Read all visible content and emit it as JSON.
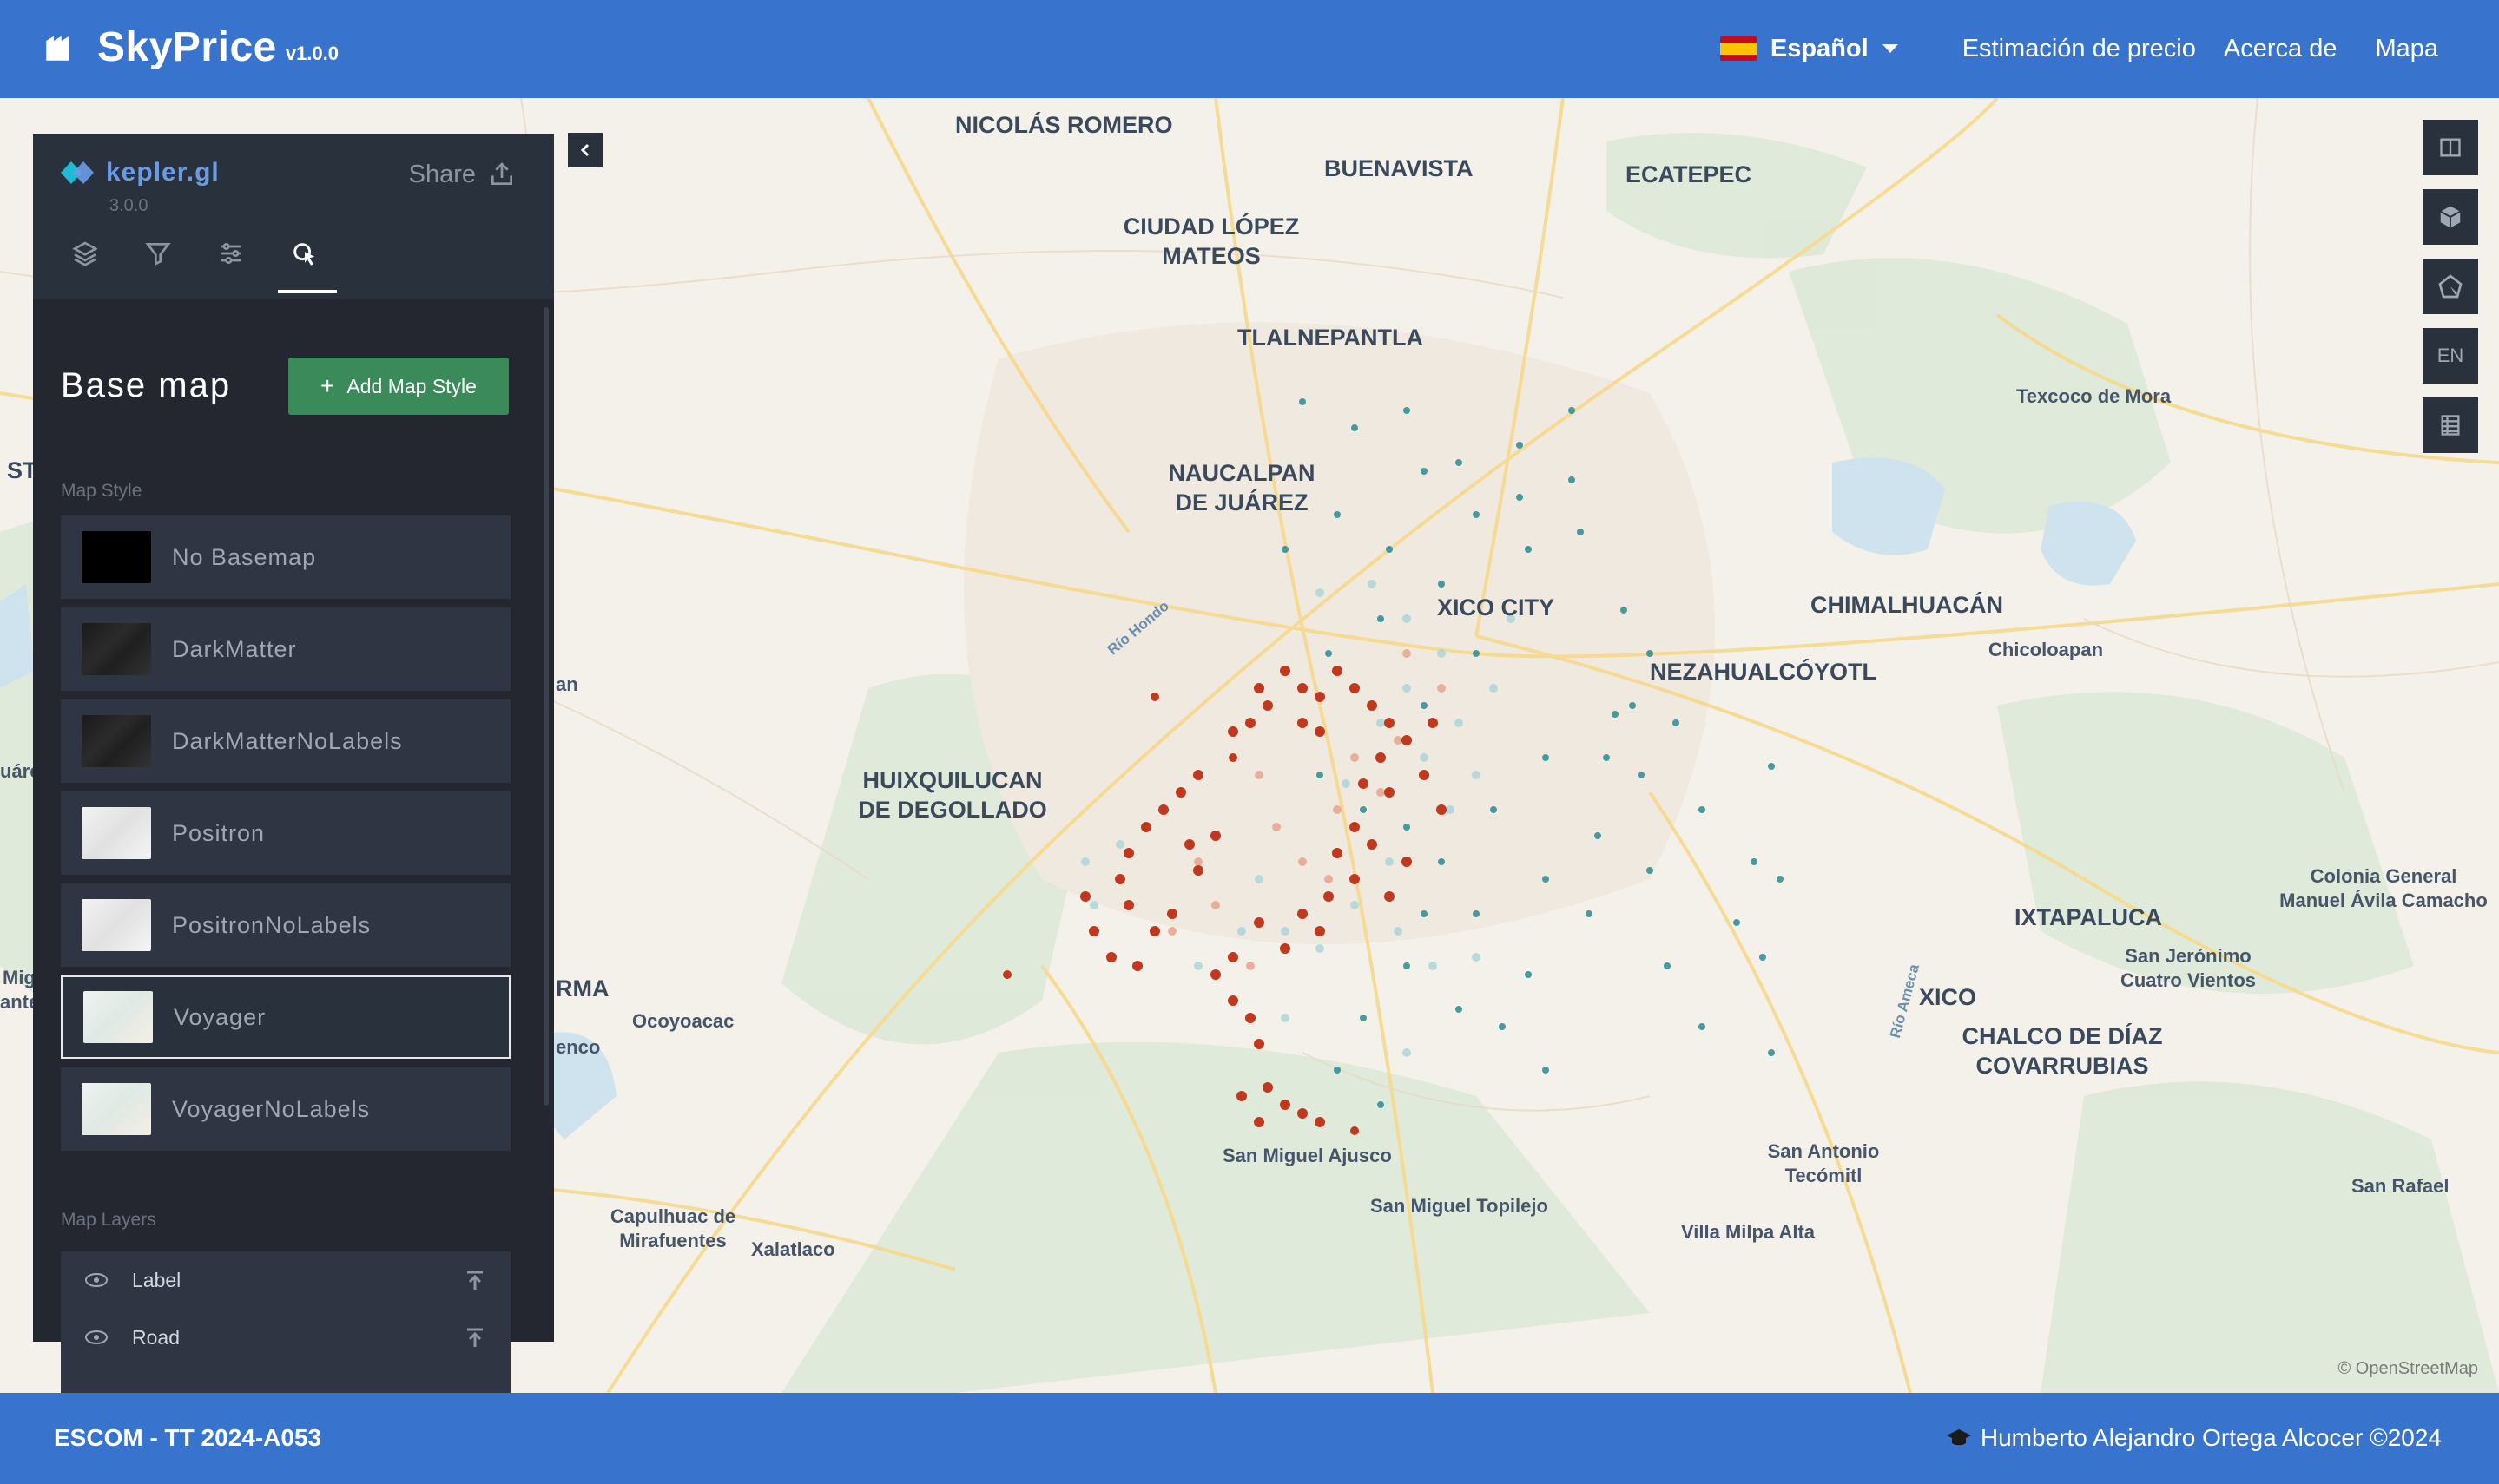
{
  "header": {
    "app_name": "SkyPrice",
    "version": "v1.0.0",
    "language": "Español",
    "nav": [
      "Estimación de precio",
      "Acerca de",
      "Mapa"
    ]
  },
  "kepler": {
    "name": "kepler.gl",
    "version": "3.0.0",
    "share_label": "Share",
    "tabs": [
      "layers",
      "filters",
      "interactions",
      "base-map"
    ],
    "active_tab": "base-map",
    "title": "Base map",
    "add_style_label": "Add Map Style",
    "map_style_label": "Map Style",
    "styles": [
      "No Basemap",
      "DarkMatter",
      "DarkMatterNoLabels",
      "Positron",
      "PositronNoLabels",
      "Voyager",
      "VoyagerNoLabels"
    ],
    "selected_style": "Voyager",
    "map_layers_label": "Map Layers",
    "layers": [
      "Label",
      "Road"
    ]
  },
  "map": {
    "places": {
      "nicolas_romero": "NICOLÁS ROMERO",
      "buenavista": "BUENAVISTA",
      "ecatepec": "ECATEPEC",
      "ciudad_lopez_mateos": "CIUDAD LÓPEZ MATEOS",
      "tlalnepantla": "TLALNEPANTLA",
      "texcoco": "Texcoco de Mora",
      "naucalpan": "NAUCALPAN DE JUÁREZ",
      "mexico_city": "XICO CITY",
      "chimalhuacan": "CHIMALHUACÁN",
      "chicoloapan": "Chicoloapan",
      "nezahualcoyotl": "NEZAHUALCÓYOTL",
      "huixquilucan": "HUIXQUILUCAN DE DEGOLLADO",
      "colonia_general": "Colonia General Manuel Ávila Camacho",
      "ixtapaluca": "IXTAPALUCA",
      "san_jeronimo": "San Jerónimo Cuatro Vientos",
      "xico": "XICO",
      "chalco": "CHALCO DE DÍAZ COVARRUBIAS",
      "ocoyoacac": "Ocoyoacac",
      "rma": "RMA",
      "san_miguel_ajusco": "San Miguel Ajusco",
      "san_antonio": "San Antonio Tecómitl",
      "san_rafael": "San Rafael",
      "capulhuac": "Capulhuac de Mirafuentes",
      "xalatlaco": "Xalatlaco",
      "san_miguel_topilejo": "San Miguel Topilejo",
      "villa_milpa_alta": "Villa Milpa Alta",
      "rio_hondo": "Río Hondo",
      "rio_amecal": "Río Ameca",
      "edge_st": "ST",
      "edge_an": "an",
      "edge_uare": "uáre",
      "edge_mig": "Mig ante",
      "edge_enco": "enco"
    },
    "attribution": "© OpenStreetMap",
    "controls": [
      "split-map",
      "3d-view",
      "draw",
      "EN",
      "legend"
    ],
    "points_colors": {
      "high": "#c0391f",
      "mid": "#e8a48e",
      "low": "#aad5d8",
      "base": "#2a8c93"
    }
  },
  "footer": {
    "left": "ESCOM - TT 2024-A053",
    "right": "Humberto Alejandro Ortega Alcocer ©2024"
  }
}
